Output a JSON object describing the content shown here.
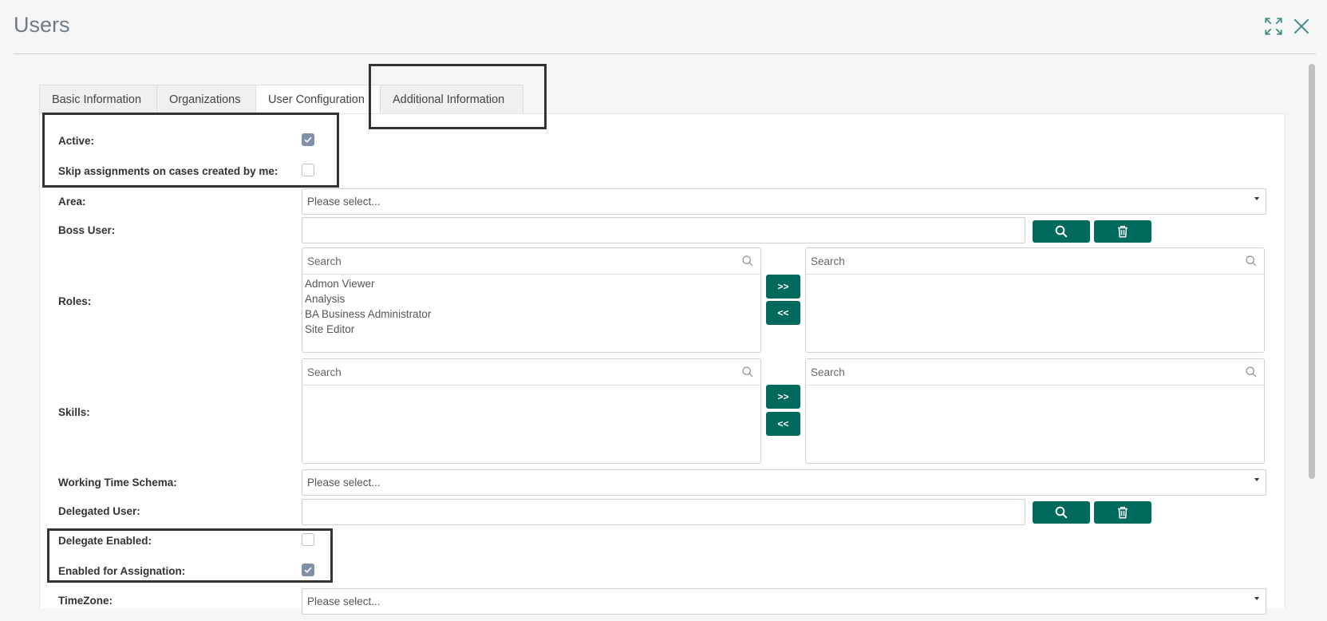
{
  "window": {
    "title": "Users"
  },
  "tabs": [
    {
      "label": "Basic Information"
    },
    {
      "label": "Organizations"
    },
    {
      "label": "User Configuration"
    },
    {
      "label": "Additional Information"
    }
  ],
  "form": {
    "active": {
      "label": "Active:",
      "checked": true
    },
    "skip_assignments": {
      "label": "Skip assignments on cases created by me:",
      "checked": false
    },
    "area": {
      "label": "Area:",
      "value": "Please select..."
    },
    "boss_user": {
      "label": "Boss User:",
      "value": ""
    },
    "roles": {
      "label": "Roles:",
      "available_search_placeholder": "Search",
      "selected_search_placeholder": "Search",
      "available": [
        "Admon Viewer",
        "Analysis",
        "BA Business Administrator",
        "Site Editor"
      ],
      "selected": [],
      "add_label": ">>",
      "remove_label": "<<"
    },
    "skills": {
      "label": "Skills:",
      "available_search_placeholder": "Search",
      "selected_search_placeholder": "Search",
      "available": [],
      "selected": [],
      "add_label": ">>",
      "remove_label": "<<"
    },
    "working_time_schema": {
      "label": "Working Time Schema:",
      "value": "Please select..."
    },
    "delegated_user": {
      "label": "Delegated User:",
      "value": ""
    },
    "delegate_enabled": {
      "label": "Delegate Enabled:",
      "checked": false
    },
    "enabled_for_assignation": {
      "label": "Enabled for Assignation:",
      "checked": true
    },
    "timezone": {
      "label": "TimeZone:",
      "value": "Please select..."
    }
  },
  "colors": {
    "accent": "#006a5c",
    "checkbox_checked": "#7f92a5",
    "title": "#6f7a86"
  },
  "icons": {
    "expand": "expand-icon",
    "close": "close-icon",
    "search": "magnifier-icon",
    "trash": "trash-icon",
    "check": "check-icon"
  }
}
